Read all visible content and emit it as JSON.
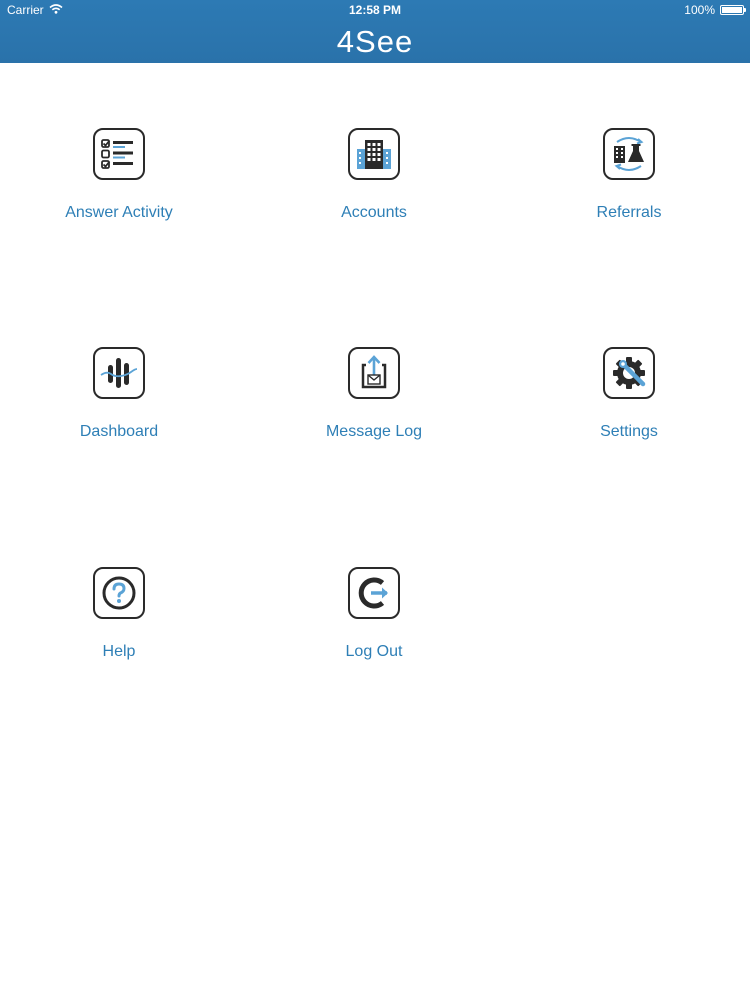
{
  "status_bar": {
    "carrier": "Carrier",
    "time": "12:58 PM",
    "battery": "100%"
  },
  "header": {
    "title": "4See"
  },
  "menu": {
    "items": [
      {
        "label": "Answer Activity",
        "icon": "checklist-icon"
      },
      {
        "label": "Accounts",
        "icon": "building-icon"
      },
      {
        "label": "Referrals",
        "icon": "building-flask-icon"
      },
      {
        "label": "Dashboard",
        "icon": "chart-bars-icon"
      },
      {
        "label": "Message Log",
        "icon": "mail-upload-icon"
      },
      {
        "label": "Settings",
        "icon": "gear-wrench-icon"
      },
      {
        "label": "Help",
        "icon": "question-icon"
      },
      {
        "label": "Log Out",
        "icon": "logout-icon"
      }
    ]
  },
  "colors": {
    "header_bg": "#2d7ab4",
    "label": "#2e7fb6",
    "icon_accent": "#5ba3d6",
    "icon_stroke": "#2a2a2a"
  }
}
